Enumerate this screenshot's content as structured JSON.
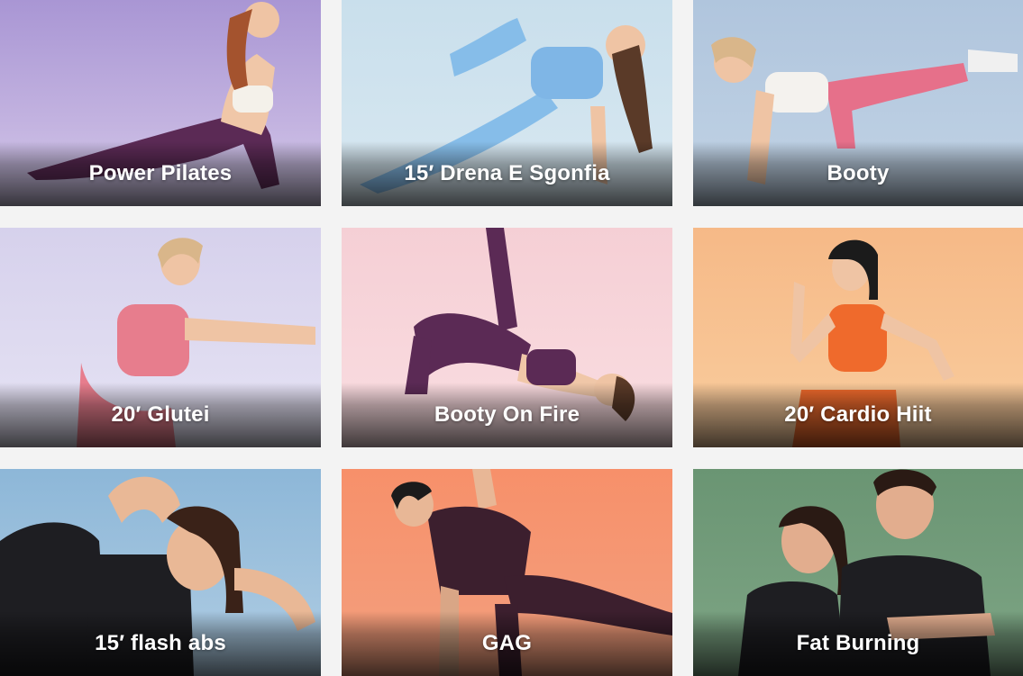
{
  "workouts": [
    {
      "title": "Power Pilates",
      "background": "#b6a4d8",
      "accent": "#5b2a55",
      "image": "woman-upward-dog-pose"
    },
    {
      "title": "15′ Drena E Sgonfia",
      "background": "#cfe2ee",
      "accent": "#7fb6e6",
      "image": "woman-side-plank-pose"
    },
    {
      "title": "Booty",
      "background": "#b7cbe0",
      "accent": "#e46c86",
      "image": "woman-kneeling-leg-lift"
    },
    {
      "title": "20′ Glutei",
      "background": "#dedbef",
      "accent": "#e77d8d",
      "image": "woman-squat-arms-forward"
    },
    {
      "title": "Booty On Fire",
      "background": "#f6d3d8",
      "accent": "#5b2a55",
      "image": "woman-glute-bridge-leg-raise"
    },
    {
      "title": "20′ Cardio Hiit",
      "background": "#f7c392",
      "accent": "#ef6a2c",
      "image": "woman-running-in-place"
    },
    {
      "title": "15′ flash abs",
      "background": "#9fc2dc",
      "accent": "#1e1e22",
      "image": "woman-crunch-pose"
    },
    {
      "title": "GAG",
      "background": "#f08d66",
      "accent": "#3c1f2e",
      "image": "woman-plank-rotation"
    },
    {
      "title": "Fat Burning",
      "background": "#6f9a78",
      "accent": "#1e1e22",
      "image": "trainers-duo-portrait"
    }
  ]
}
